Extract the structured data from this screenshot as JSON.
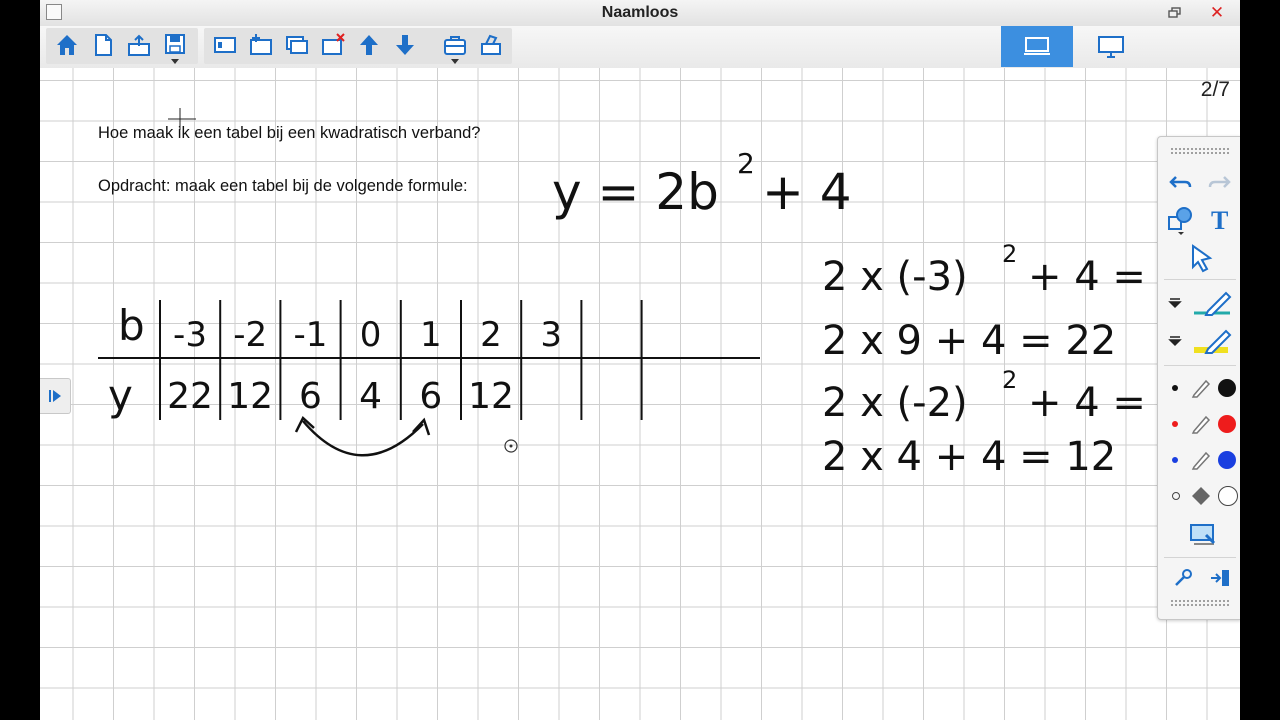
{
  "app": {
    "title": "Naamloos",
    "page_indicator": "2/7"
  },
  "toolbar": {
    "buttons": [
      "home-icon",
      "new-document-icon",
      "open-icon",
      "save-icon",
      "page-sorter-icon",
      "add-page-icon",
      "duplicate-page-icon",
      "delete-page-icon",
      "up-arrow-icon",
      "down-arrow-icon",
      "toolbox-icon",
      "scanner-icon"
    ],
    "views": [
      "whiteboard-view-icon",
      "monitor-view-icon"
    ],
    "active_view": "whiteboard-view-icon",
    "accent": "#3c8fe0"
  },
  "canvas": {
    "question": "Hoe maak ik een tabel bij een kwadratisch verband?",
    "assignment": "Opdracht: maak een tabel bij de volgende formule:",
    "formula": {
      "lhs": "y = 2b",
      "exponent": "2",
      "rhs": "+ 4"
    },
    "table": {
      "b_label": "b",
      "y_label": "y",
      "b_values": [
        "-3",
        "-2",
        "-1",
        "0",
        "1",
        "2",
        "3",
        "",
        ""
      ],
      "y_values": [
        "22",
        "12",
        "6",
        "4",
        "6",
        "12",
        "",
        "",
        ""
      ]
    },
    "work": [
      {
        "text": "2 x (-3)",
        "exp": "2",
        "tail": "+ 4 ="
      },
      {
        "text": "2 x 9 + 4 = 22",
        "exp": "",
        "tail": ""
      },
      {
        "text": "2 x (-2)",
        "exp": "2",
        "tail": "+ 4 ="
      },
      {
        "text": "2 x 4 + 4 = 12",
        "exp": "",
        "tail": ""
      }
    ]
  },
  "palette": {
    "tools": [
      "undo-icon",
      "redo-icon",
      "shapes-icon",
      "text-icon",
      "select-arrow-icon",
      "pen-icon",
      "highlighter-icon",
      "black-pen-icon",
      "red-pen-icon",
      "blue-pen-icon",
      "eraser-icon",
      "screen-capture-icon",
      "pin-icon",
      "dock-icon"
    ],
    "colors": {
      "black": "#111111",
      "red": "#ee1c1c",
      "blue": "#1a3fe0",
      "highlighter": "#f0e020",
      "pen": "#2a8fd8"
    }
  }
}
